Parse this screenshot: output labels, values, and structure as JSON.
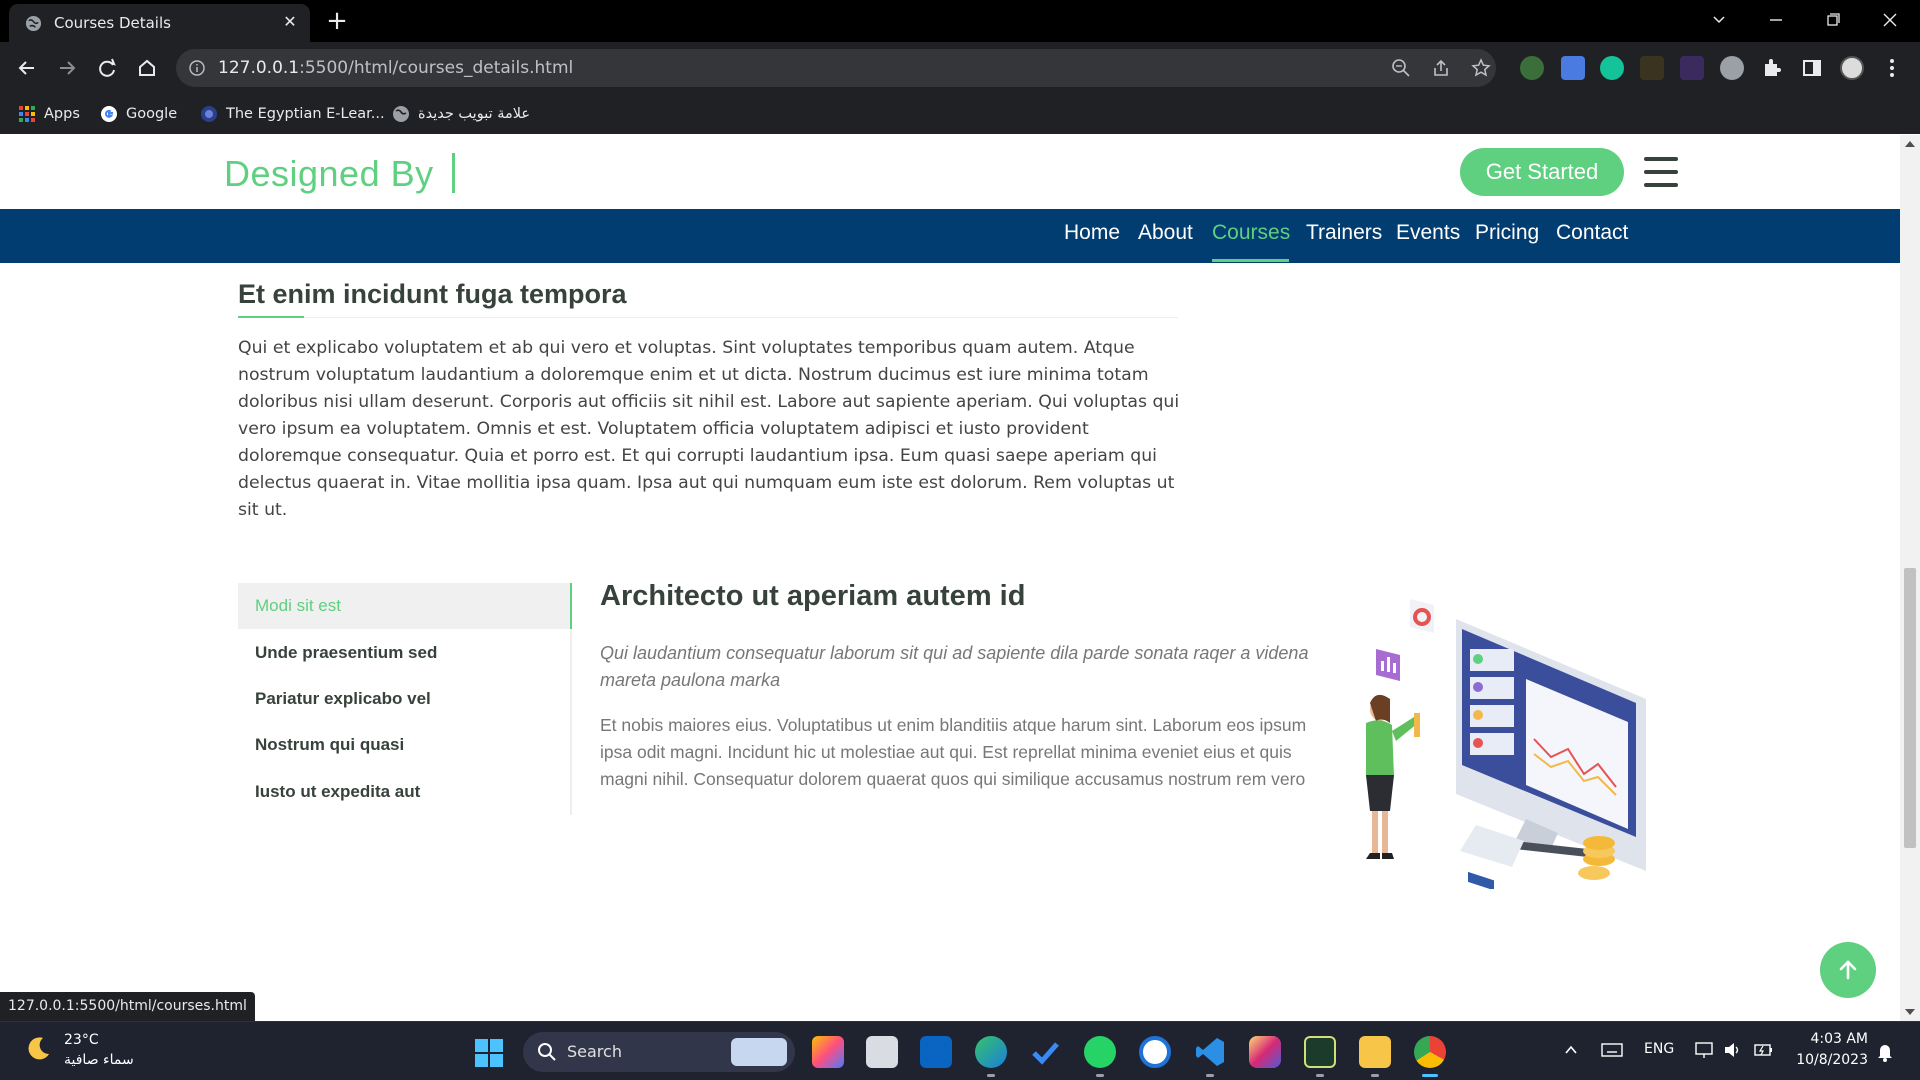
{
  "browser": {
    "tab_title": "Courses Details",
    "url_host": "127.0.0.1",
    "url_rest": ":5500/html/courses_details.html",
    "bookmarks": [
      "Apps",
      "Google",
      "The Egyptian E-Lear...",
      "علامة تبويب جديدة"
    ],
    "status_url": "127.0.0.1:5500/html/courses.html"
  },
  "site": {
    "logo": "Designed By",
    "cta": "Get Started",
    "nav": [
      "Home",
      "About",
      "Courses",
      "Trainers",
      "Events",
      "Pricing",
      "Contact"
    ],
    "active_nav": "Courses"
  },
  "content": {
    "heading": "Et enim incidunt fuga tempora",
    "body": "Qui et explicabo voluptatem et ab qui vero et voluptas. Sint voluptates temporibus quam autem. Atque nostrum voluptatum laudantium a doloremque enim et ut dicta. Nostrum ducimus est iure minima totam doloribus nisi ullam deserunt. Corporis aut officiis sit nihil est. Labore aut sapiente aperiam. Qui voluptas qui vero ipsum ea voluptatem. Omnis et est. Voluptatem officia voluptatem adipisci et iusto provident doloremque consequatur. Quia et porro est. Et qui corrupti laudantium ipsa. Eum quasi saepe aperiam qui delectus quaerat in. Vitae mollitia ipsa quam. Ipsa aut qui numquam eum iste est dolorum. Rem voluptas ut sit ut.",
    "tabs": [
      "Modi sit est",
      "Unde praesentium sed",
      "Pariatur explicabo vel",
      "Nostrum qui quasi",
      "Iusto ut expedita aut"
    ],
    "active_tab": "Modi sit est",
    "detail_title": "Architecto ut aperiam autem id",
    "detail_italic": "Qui laudantium consequatur laborum sit qui ad sapiente dila parde sonata raqer a videna mareta paulona marka",
    "detail_body": "Et nobis maiores eius. Voluptatibus ut enim blanditiis atque harum sint. Laborum eos ipsum ipsa odit magni. Incidunt hic ut molestiae aut qui. Est reprellat minima eveniet eius et quis magni nihil. Consequatur dolorem quaerat quos qui similique accusamus nostrum rem vero"
  },
  "taskbar": {
    "weather_temp": "23°C",
    "weather_cond": "سماء صافية",
    "search_label": "Search",
    "language": "ENG",
    "time": "4:03 AM",
    "date": "10/8/2023"
  },
  "colors": {
    "accent": "#5fcf80",
    "navbar": "#013d70",
    "text_dark": "#37423b"
  }
}
